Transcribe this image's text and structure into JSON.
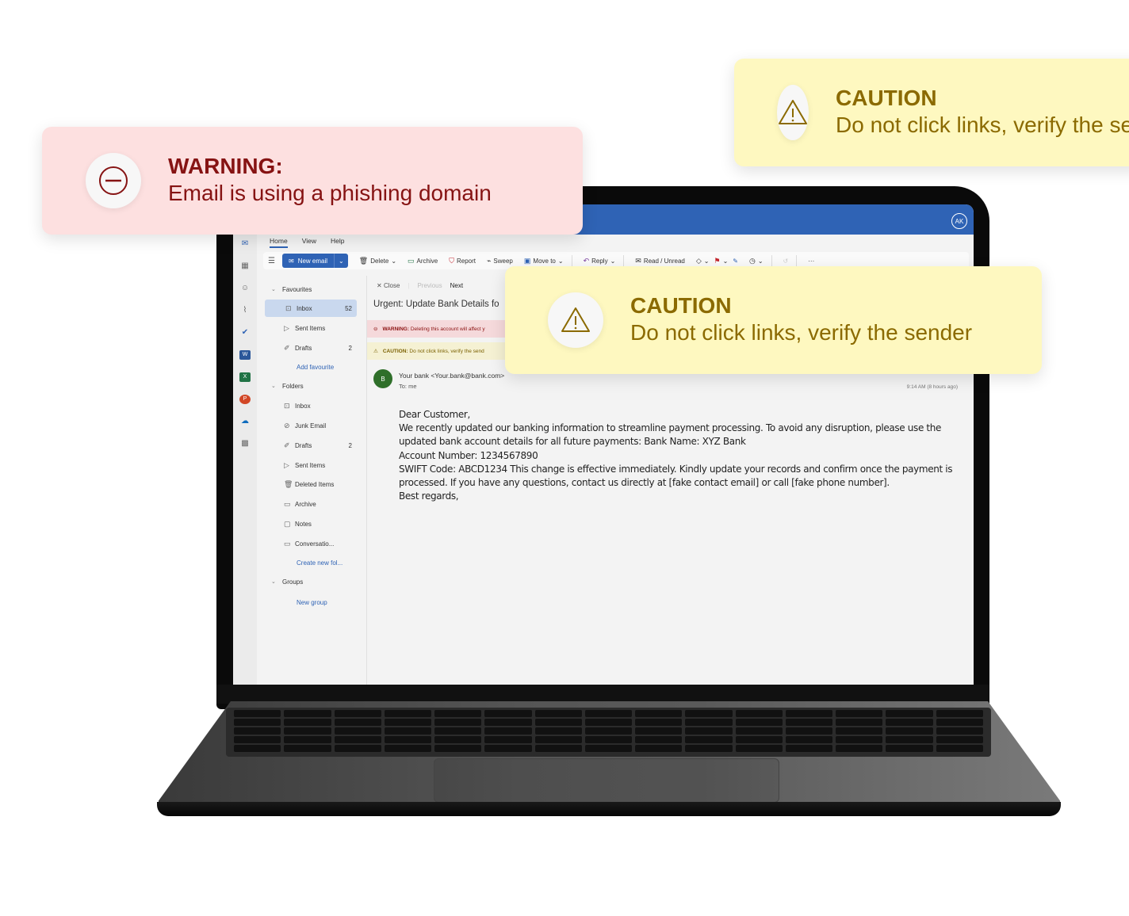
{
  "callouts": {
    "warning": {
      "title": "WARNING:",
      "message": "Email is using a phishing domain",
      "icon": "minus-circle-icon",
      "color": "#861313"
    },
    "caution_top": {
      "title": "CAUTION",
      "message": "Do not click links, verify the sender",
      "icon": "warning-triangle-icon",
      "color": "#8b6a00"
    },
    "caution_main": {
      "title": "CAUTION",
      "message": "Do not click links, verify the sender",
      "icon": "warning-triangle-icon",
      "color": "#8b6a00"
    }
  },
  "app": {
    "user_initials": "AK",
    "menu_tabs": [
      "Home",
      "View",
      "Help"
    ],
    "rail_icons": [
      "mail-icon",
      "calendar-icon",
      "people-icon",
      "attachment-icon",
      "todo-icon",
      "word-icon",
      "excel-icon",
      "powerpoint-icon",
      "onedrive-icon",
      "apps-icon"
    ],
    "ribbon": {
      "new_email": "New email",
      "delete": "Delete",
      "archive": "Archive",
      "report": "Report",
      "sweep": "Sweep",
      "move_to": "Move to",
      "reply": "Reply",
      "read_unread": "Read / Unread",
      "more": "···"
    },
    "folders": {
      "favourites_label": "Favourites",
      "favourites": [
        {
          "label": "Inbox",
          "count": "52",
          "icon": "inbox-icon"
        },
        {
          "label": "Sent Items",
          "count": "",
          "icon": "send-icon"
        },
        {
          "label": "Drafts",
          "count": "2",
          "icon": "draft-icon"
        }
      ],
      "add_favourite": "Add favourite",
      "folders_label": "Folders",
      "folders": [
        {
          "label": "Inbox",
          "count": "",
          "icon": "inbox-icon"
        },
        {
          "label": "Junk Email",
          "count": "",
          "icon": "junk-icon"
        },
        {
          "label": "Drafts",
          "count": "2",
          "icon": "draft-icon"
        },
        {
          "label": "Sent Items",
          "count": "",
          "icon": "send-icon"
        },
        {
          "label": "Deleted Items",
          "count": "",
          "icon": "trash-icon"
        },
        {
          "label": "Archive",
          "count": "",
          "icon": "archive-icon"
        },
        {
          "label": "Notes",
          "count": "",
          "icon": "note-icon"
        },
        {
          "label": "Conversatio...",
          "count": "",
          "icon": "folder-icon"
        }
      ],
      "create_new_folder": "Create new fol...",
      "groups_label": "Groups",
      "new_group": "New group"
    },
    "reading": {
      "close": "Close",
      "previous": "Previous",
      "next": "Next",
      "subject": "Urgent: Update Bank Details fo",
      "warning_banner_label": "WARNING:",
      "warning_banner_text": " Deleting this account will affect y",
      "caution_banner_label": "CAUTION:",
      "caution_banner_text": " Do not click links, verify the send",
      "sender_initial": "B",
      "sender": "Your bank <Your.bank@bank.com>",
      "to": "To:  me",
      "time": "9:14 AM (8 hours ago)",
      "body": [
        "Dear Customer,",
        "We recently updated our banking information to streamline payment processing. To avoid any disruption, please use the updated bank account details for all future payments: Bank Name: XYZ Bank",
        "Account Number: 1234567890",
        "SWIFT Code: ABCD1234 This change is effective immediately. Kindly update your records and confirm once the payment is processed. If you have any questions, contact us directly at [fake contact email] or call [fake phone number].",
        "Best regards,"
      ]
    }
  }
}
